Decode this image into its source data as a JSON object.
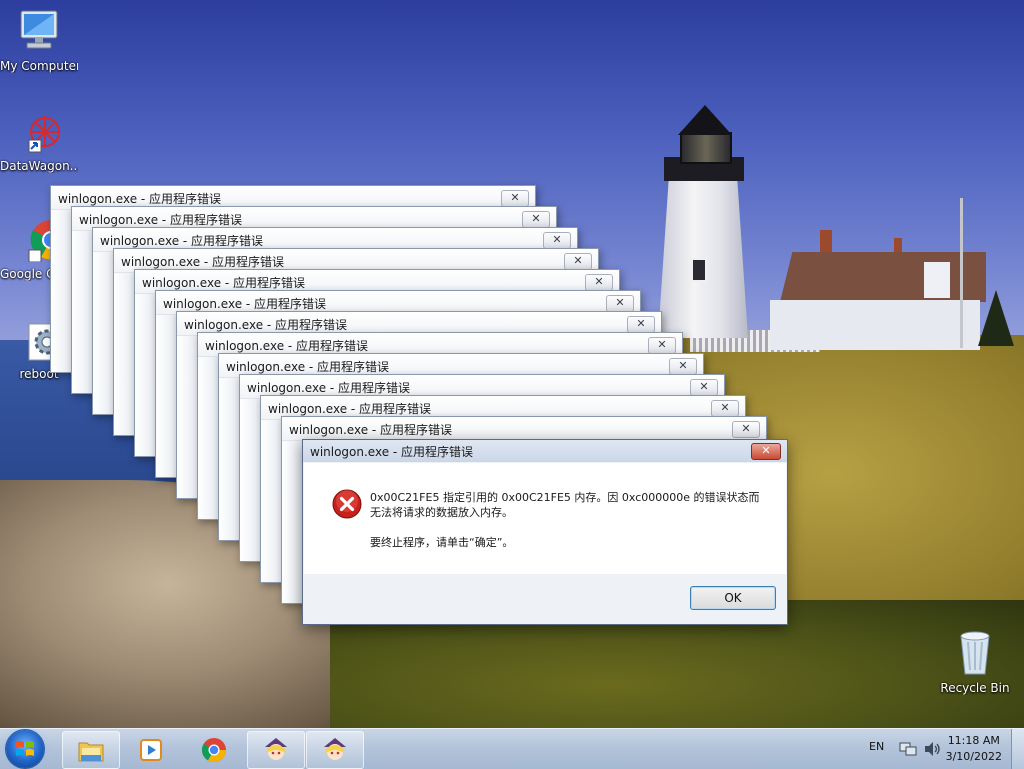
{
  "desktop": {
    "icons": [
      {
        "label": "My Computer",
        "icon": "computer-icon"
      },
      {
        "label": "DataWagon...",
        "icon": "datawagon-icon"
      },
      {
        "label": "Google Chrome",
        "icon": "chrome-icon"
      },
      {
        "label": "reboot",
        "icon": "gear-icon"
      },
      {
        "label": "Recycle Bin",
        "icon": "recycle-bin-icon"
      }
    ]
  },
  "error_windows": {
    "title": "winlogon.exe - 应用程序错误",
    "close_glyph": "✕"
  },
  "dialog": {
    "title": "winlogon.exe - 应用程序错误",
    "close_glyph": "✕",
    "message_line1": "0x00C21FE5 指定引用的 0x00C21FE5 内存。因 0xc000000e 的错误状态而",
    "message_line2": "无法将请求的数据放入内存。",
    "message_line3": "要终止程序，请单击“确定”。",
    "ok_label": "OK",
    "icon": "error-icon"
  },
  "taskbar": {
    "items": [
      {
        "icon": "windows-start-icon"
      },
      {
        "icon": "folder-icon"
      },
      {
        "icon": "media-player-icon"
      },
      {
        "icon": "chrome-icon"
      },
      {
        "icon": "anime-avatar-icon"
      },
      {
        "icon": "anime-avatar-icon"
      }
    ],
    "language": "EN",
    "time": "11:18 AM",
    "date": "3/10/2022"
  },
  "colors": {
    "taskbar": "#b3c4da",
    "dialog_bg": "#f0f0f0",
    "close_red": "#c84a35",
    "error_red": "#c8201a"
  }
}
